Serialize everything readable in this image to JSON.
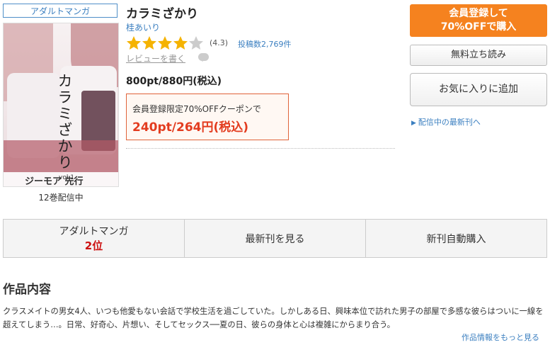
{
  "category_tag": "アダルトマンガ",
  "cover": {
    "title_vertical": "カラミざかり",
    "volume": "vol.1",
    "publisher_mark": "ジーモア 先行"
  },
  "volume_count": "12巻配信中",
  "title": "カラミざかり",
  "author": "桂あいり",
  "rating": {
    "stars": 4,
    "max": 5,
    "value_text": "(4.3)",
    "reviews_text": "投稿数2,769件"
  },
  "write_review": "レビューを書く",
  "price": "800pt/880円(税込)",
  "coupon": {
    "label": "会員登録限定70%OFFクーポンで",
    "sale_price": "240pt/264円(税込)"
  },
  "buttons": {
    "register_line1": "会員登録して",
    "register_line2": "70%OFFで購入",
    "sample": "無料立ち読み",
    "favorite": "お気に入りに追加"
  },
  "latest_link": "配信中の最新刊へ",
  "tabs": [
    {
      "label": "アダルトマンガ",
      "rank": "2位"
    },
    {
      "label": "最新刊を見る"
    },
    {
      "label": "新刊自動購入"
    }
  ],
  "description": {
    "heading": "作品内容",
    "text": "クラスメイトの男女4人、いつも他愛もない会話で学校生活を過ごしていた。しかしある日、興味本位で訪れた男子の部屋で多感な彼らはついに一線を超えてしまう…。日常、好奇心、片想い、そしてセックス──夏の日、彼らの身体と心は複雑にからまり合う。",
    "more_link": "作品情報をもっと見る"
  },
  "colors": {
    "accent_orange": "#f5821f",
    "link_blue": "#3b7fc0",
    "sale_red": "#e33c1f",
    "star_gold": "#f5b301"
  }
}
